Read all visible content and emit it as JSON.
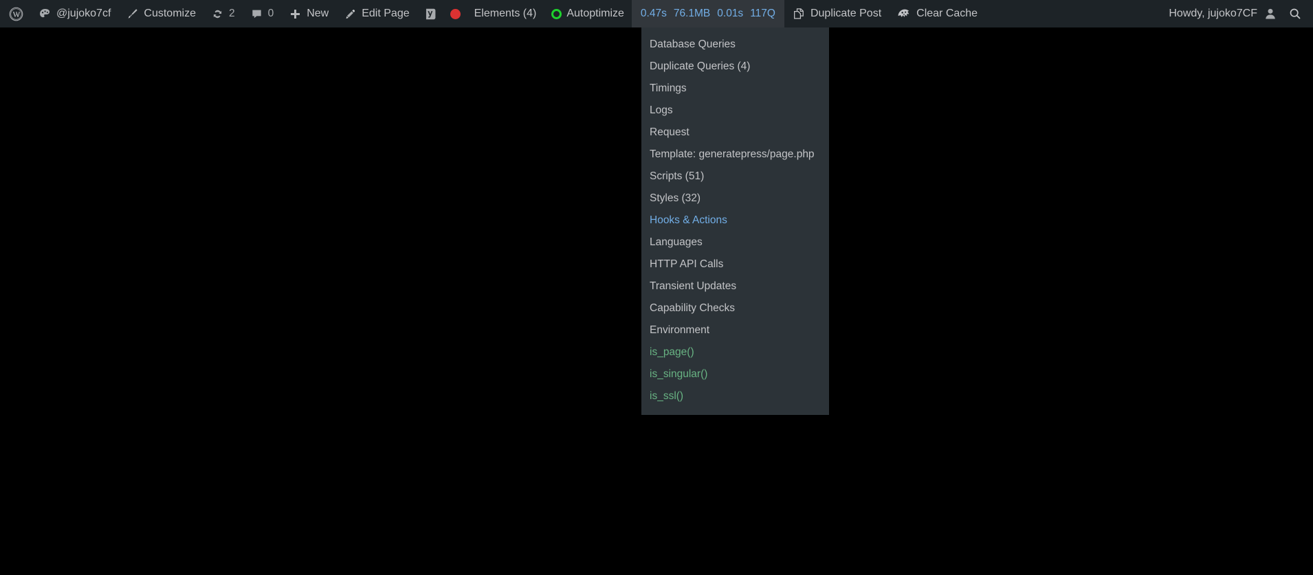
{
  "colors": {
    "adminbar_bg": "#1d2327",
    "menu_bg": "#2c3338",
    "qm_active_bg": "#32373c",
    "text": "#c3c4c7",
    "link_blue": "#72aee6",
    "conditional_green": "#68b383",
    "seo_red": "#dc3232",
    "autoptimize_green": "#1ed12d",
    "page_bg": "#000000"
  },
  "adminbar": {
    "left_items": [
      {
        "name": "wp-logo",
        "icon": "wordpress-icon",
        "label": ""
      },
      {
        "name": "site-name",
        "icon": "dashboard-palette-icon",
        "label": "@jujoko7cf"
      },
      {
        "name": "customize",
        "icon": "paintbrush-icon",
        "label": "Customize"
      },
      {
        "name": "updates",
        "icon": "updates-sync-icon",
        "label": "2"
      },
      {
        "name": "comments",
        "icon": "comment-bubble-icon",
        "label": "0"
      },
      {
        "name": "new-content",
        "icon": "plus-icon",
        "label": "New"
      },
      {
        "name": "edit-page",
        "icon": "pencil-icon",
        "label": "Edit Page"
      },
      {
        "name": "yoast-seo",
        "icon": "yoast-logo-icon",
        "label": ""
      },
      {
        "name": "seo-score",
        "icon": "red-dot-icon",
        "label": ""
      },
      {
        "name": "elements",
        "icon": "",
        "label": "Elements (4)"
      },
      {
        "name": "autoptimize",
        "icon": "green-ring-icon",
        "label": "Autoptimize"
      }
    ],
    "query_monitor": {
      "time": "0.47s",
      "memory": "76.1MB",
      "db_time": "0.01s",
      "queries": "117Q"
    },
    "duplicate_post": {
      "icon": "duplicate-pages-icon",
      "label": "Duplicate Post"
    },
    "clear_cache": {
      "icon": "wp-rocket-icon",
      "label": "Clear Cache"
    },
    "howdy": {
      "label": "Howdy, jujoko7CF",
      "icon": "avatar-icon"
    },
    "search": {
      "icon": "search-icon"
    }
  },
  "qm_menu": {
    "items": [
      {
        "label": "Database Queries",
        "state": "default"
      },
      {
        "label": "Duplicate Queries (4)",
        "state": "default"
      },
      {
        "label": "Timings",
        "state": "default"
      },
      {
        "label": "Logs",
        "state": "default"
      },
      {
        "label": "Request",
        "state": "default"
      },
      {
        "label": "Template: generatepress/page.php",
        "state": "default"
      },
      {
        "label": "Scripts (51)",
        "state": "default"
      },
      {
        "label": "Styles (32)",
        "state": "default"
      },
      {
        "label": "Hooks & Actions",
        "state": "hovered"
      },
      {
        "label": "Languages",
        "state": "default"
      },
      {
        "label": "HTTP API Calls",
        "state": "default"
      },
      {
        "label": "Transient Updates",
        "state": "default"
      },
      {
        "label": "Capability Checks",
        "state": "default"
      },
      {
        "label": "Environment",
        "state": "default"
      },
      {
        "label": "is_page()",
        "state": "conditional"
      },
      {
        "label": "is_singular()",
        "state": "conditional"
      },
      {
        "label": "is_ssl()",
        "state": "conditional"
      }
    ]
  }
}
